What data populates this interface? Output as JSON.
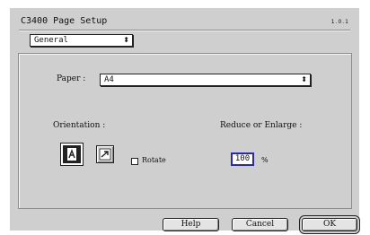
{
  "window": {
    "title": "C3400 Page Setup",
    "version": "1.0.1"
  },
  "section_popup": {
    "value": "General",
    "arrow": "⬍"
  },
  "paper": {
    "label": "Paper :",
    "value": "A4",
    "arrow": "⬍"
  },
  "orientation": {
    "label": "Orientation :",
    "portrait_icon": "portrait-orientation-icon",
    "landscape_icon": "landscape-orientation-icon",
    "selected": "portrait",
    "rotate_label": "Rotate",
    "rotate_checked": false
  },
  "scale": {
    "label": "Reduce or Enlarge :",
    "value": "100",
    "unit": "%"
  },
  "buttons": {
    "help": "Help",
    "cancel": "Cancel",
    "ok": "OK"
  }
}
